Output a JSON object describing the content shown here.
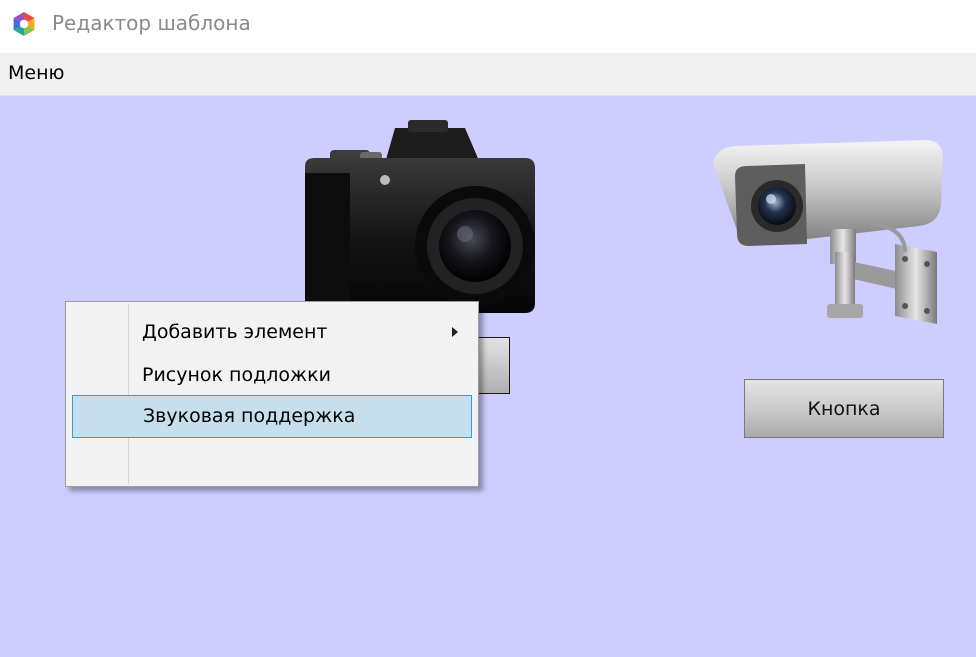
{
  "window": {
    "title": "Редактор шаблона",
    "logo_icon": "app-logo-icon"
  },
  "menubar": {
    "menu_label": "Меню"
  },
  "canvas": {
    "background": "#cecdff",
    "button_label": "Кнопка",
    "photo_camera_icon": "photo-camera-icon",
    "cctv_camera_icon": "cctv-camera-icon"
  },
  "context_menu": {
    "items": [
      {
        "label": "Добавить элемент",
        "has_submenu": true
      },
      {
        "label": "Рисунок подложки",
        "has_submenu": false
      },
      {
        "label": "Звуковая поддержка",
        "has_submenu": false,
        "highlighted": true
      }
    ],
    "highlight_color": "#c5e0ec",
    "highlight_border": "#3a9ad6"
  }
}
